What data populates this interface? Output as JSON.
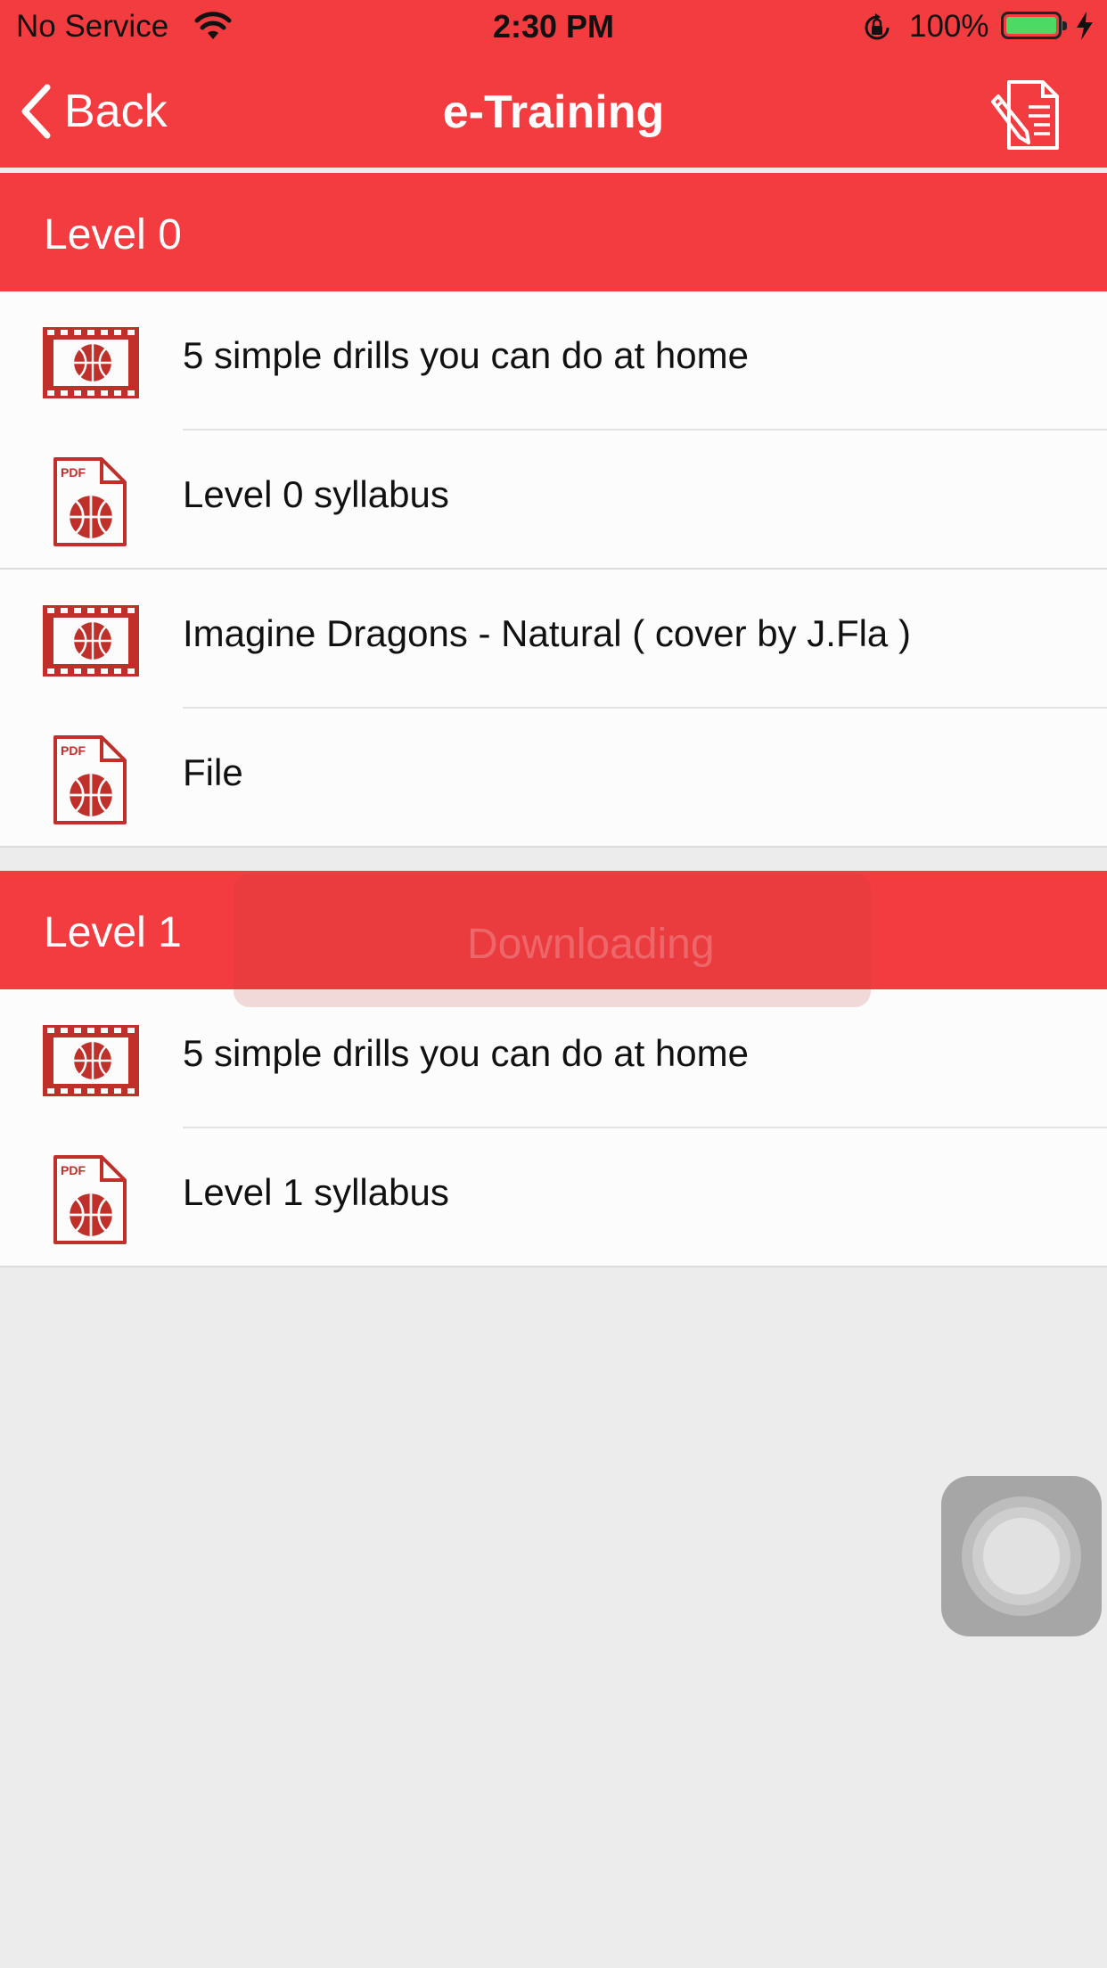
{
  "status_bar": {
    "carrier": "No Service",
    "time": "2:30 PM",
    "battery_percent": "100%",
    "battery_level": 1.0,
    "battery_color": "#4cd964"
  },
  "nav": {
    "back_label": "Back",
    "title": "e-Training",
    "right_icon": "document-edit-icon"
  },
  "theme": {
    "accent": "#f23c40",
    "icon_color": "#c0302a",
    "background": "#ececec"
  },
  "sections": [
    {
      "title": "Level 0",
      "items": [
        {
          "label": "5 simple drills you can do at home",
          "icon": "video-icon"
        },
        {
          "label": "Level 0 syllabus",
          "icon": "pdf-icon"
        },
        {
          "label": "Imagine Dragons - Natural ( cover by J.Fla )",
          "icon": "video-icon"
        },
        {
          "label": "File",
          "icon": "pdf-icon"
        }
      ]
    },
    {
      "title": "Level 1",
      "items": [
        {
          "label": "5 simple drills you can do at home",
          "icon": "video-icon"
        },
        {
          "label": "Level 1 syllabus",
          "icon": "pdf-icon"
        }
      ]
    }
  ],
  "pdf_badge": "PDF",
  "overlay_text": "Downloading"
}
